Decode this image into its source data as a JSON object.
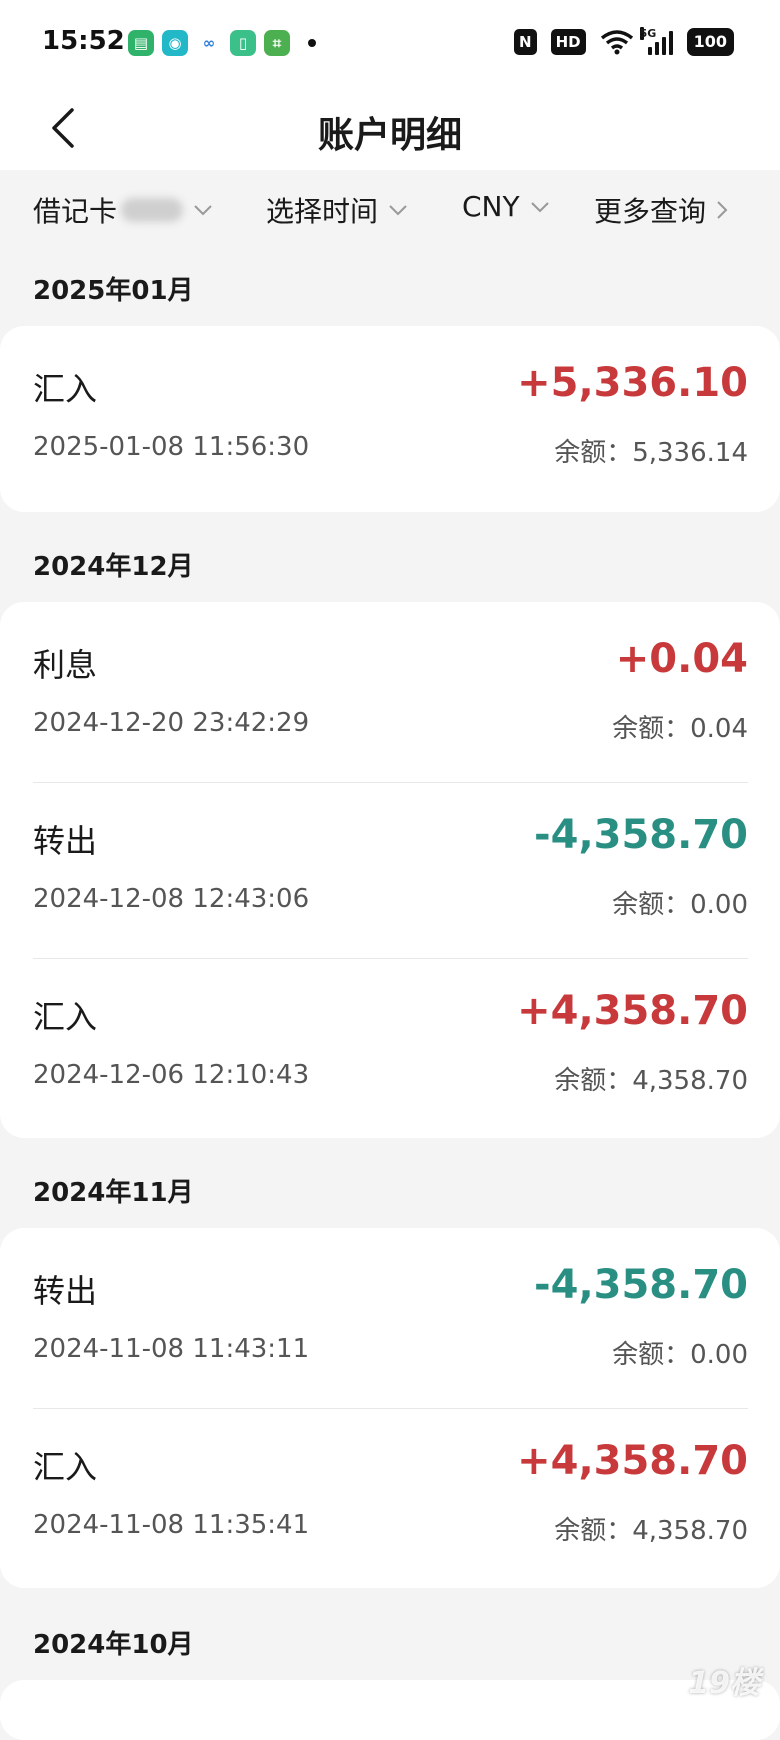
{
  "status_bar": {
    "time": "15:52",
    "nfc": "N",
    "hd": "HD",
    "network": "5G",
    "battery": "100"
  },
  "nav": {
    "title": "账户明细"
  },
  "filters": {
    "card_label": "借记卡",
    "time_label": "选择时间",
    "currency_label": "CNY",
    "more_label": "更多查询"
  },
  "groups": [
    {
      "month": "2025年01月",
      "transactions": [
        {
          "type": "汇入",
          "amount": "+5,336.10",
          "datetime": "2025-01-08 11:56:30",
          "balance": "余额：5,336.14"
        }
      ]
    },
    {
      "month": "2024年12月",
      "transactions": [
        {
          "type": "利息",
          "amount": "+0.04",
          "datetime": "2024-12-20 23:42:29",
          "balance": "余额：0.04"
        },
        {
          "type": "转出",
          "amount": "-4,358.70",
          "datetime": "2024-12-08 12:43:06",
          "balance": "余额：0.00"
        },
        {
          "type": "汇入",
          "amount": "+4,358.70",
          "datetime": "2024-12-06 12:10:43",
          "balance": "余额：4,358.70"
        }
      ]
    },
    {
      "month": "2024年11月",
      "transactions": [
        {
          "type": "转出",
          "amount": "-4,358.70",
          "datetime": "2024-11-08 11:43:11",
          "balance": "余额：0.00"
        },
        {
          "type": "汇入",
          "amount": "+4,358.70",
          "datetime": "2024-11-08 11:35:41",
          "balance": "余额：4,358.70"
        }
      ]
    },
    {
      "month": "2024年10月",
      "transactions": []
    }
  ],
  "watermark": "19楼",
  "colors": {
    "income": "#c8393b",
    "expense": "#2a8f83"
  }
}
